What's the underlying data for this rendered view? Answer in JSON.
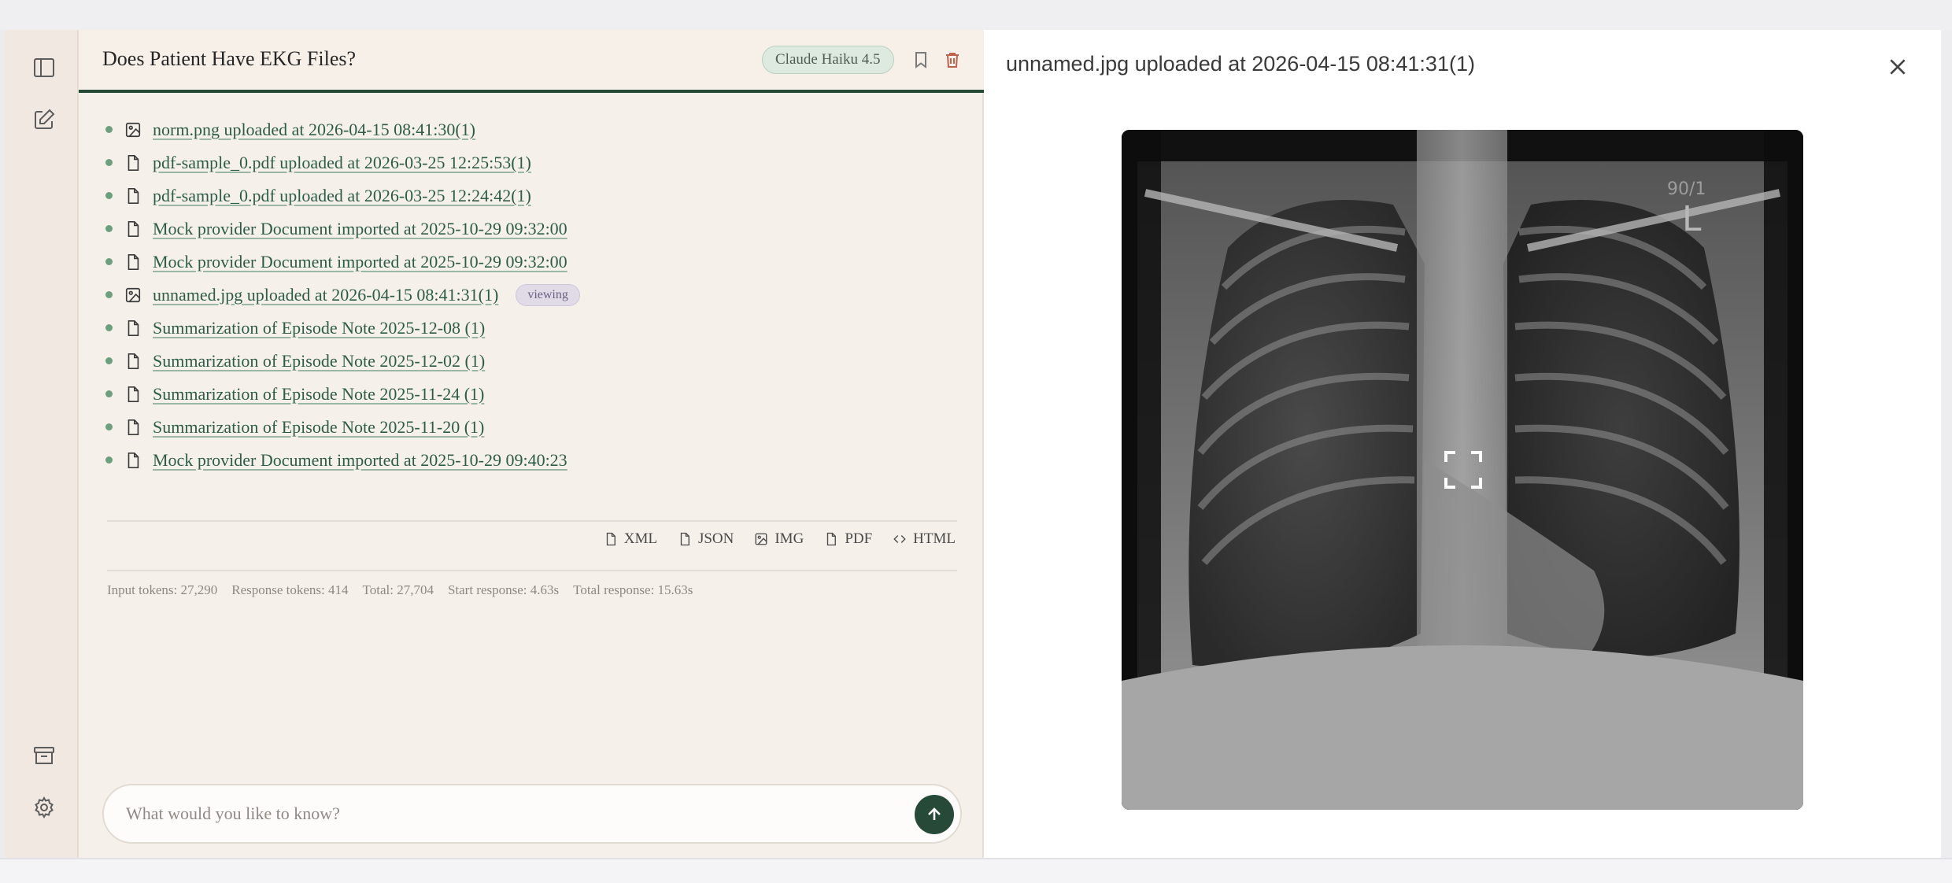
{
  "chat": {
    "title": "Does Patient Have EKG Files?",
    "model": "Claude Haiku 4.5",
    "documents": [
      {
        "icon": "image-icon",
        "label": "norm.png uploaded at 2026-04-15 08:41:30(1)",
        "viewing": false
      },
      {
        "icon": "file-icon",
        "label": "pdf-sample_0.pdf uploaded at 2026-03-25 12:25:53(1)",
        "viewing": false
      },
      {
        "icon": "file-icon",
        "label": "pdf-sample_0.pdf uploaded at 2026-03-25 12:24:42(1)",
        "viewing": false
      },
      {
        "icon": "file-icon",
        "label": "Mock provider Document imported at 2025-10-29 09:32:00",
        "viewing": false
      },
      {
        "icon": "file-icon",
        "label": "Mock provider Document imported at 2025-10-29 09:32:00",
        "viewing": false
      },
      {
        "icon": "image-icon",
        "label": "unnamed.jpg uploaded at 2026-04-15 08:41:31(1)",
        "viewing": true
      },
      {
        "icon": "file-icon",
        "label": "Summarization of Episode Note 2025-12-08 (1)",
        "viewing": false
      },
      {
        "icon": "file-icon",
        "label": "Summarization of Episode Note 2025-12-02 (1)",
        "viewing": false
      },
      {
        "icon": "file-icon",
        "label": "Summarization of Episode Note 2025-11-24 (1)",
        "viewing": false
      },
      {
        "icon": "file-icon",
        "label": "Summarization of Episode Note 2025-11-20 (1)",
        "viewing": false
      },
      {
        "icon": "file-icon",
        "label": "Mock provider Document imported at 2025-10-29 09:40:23",
        "viewing": false
      }
    ],
    "viewing_label": "viewing",
    "formats": [
      {
        "icon": "file-icon",
        "label": "XML"
      },
      {
        "icon": "file-icon",
        "label": "JSON"
      },
      {
        "icon": "image-icon",
        "label": "IMG"
      },
      {
        "icon": "file-icon",
        "label": "PDF"
      },
      {
        "icon": "code-icon",
        "label": "HTML"
      }
    ],
    "stats": [
      "Input tokens: 27,290",
      "Response tokens: 414",
      "Total: 27,704",
      "Start response: 4.63s",
      "Total response: 15.63s"
    ],
    "input_placeholder": "What would you like to know?"
  },
  "viewer": {
    "title": "unnamed.jpg uploaded at 2026-04-15 08:41:31(1)",
    "image_marker_text": "90/1",
    "image_side_marker": "L"
  },
  "colors": {
    "accent": "#264a37",
    "link": "#2c5d48",
    "bullet": "#6aa07e",
    "delete": "#c0614c"
  }
}
